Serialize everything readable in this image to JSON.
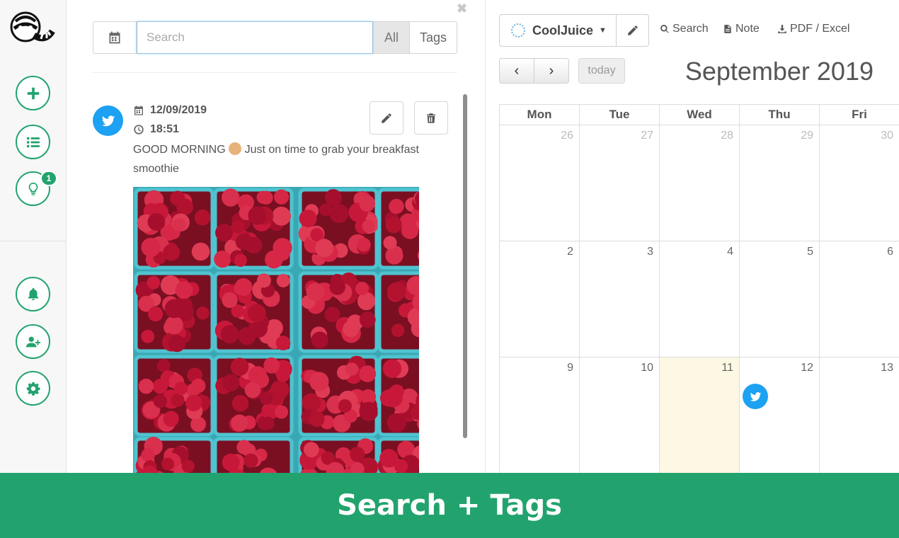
{
  "sidebar": {
    "logo": "raccoon-logo",
    "buttons": [
      {
        "icon": "plus-icon"
      },
      {
        "icon": "list-icon"
      },
      {
        "icon": "lightbulb-icon",
        "badge": "1"
      },
      {
        "icon": "bell-icon"
      },
      {
        "icon": "user-plus-icon"
      },
      {
        "icon": "gear-icon"
      }
    ]
  },
  "search": {
    "placeholder": "Search",
    "value": "",
    "filter_all": "All",
    "filter_tags": "Tags"
  },
  "post": {
    "network": "twitter",
    "date": "12/09/2019",
    "time": "18:51",
    "text_before": "GOOD MORNING",
    "text_after": "Just on time to grab your breakfast smoothie",
    "image": "raspberries"
  },
  "calendar": {
    "account": "CoolJuice",
    "links": {
      "search": "Search",
      "note": "Note",
      "export": "PDF / Excel"
    },
    "today_label": "today",
    "month_title": "September 2019",
    "weekdays": [
      "Mon",
      "Tue",
      "Wed",
      "Thu",
      "Fri"
    ],
    "weeks": [
      [
        "26",
        "27",
        "28",
        "29",
        "30"
      ],
      [
        "2",
        "3",
        "4",
        "5",
        "6"
      ],
      [
        "9",
        "10",
        "11",
        "12",
        "13"
      ]
    ]
  },
  "banner": "Search + Tags",
  "colors": {
    "accent": "#22a36e",
    "twitter": "#1da1f2",
    "today": "#fcf8e3"
  }
}
